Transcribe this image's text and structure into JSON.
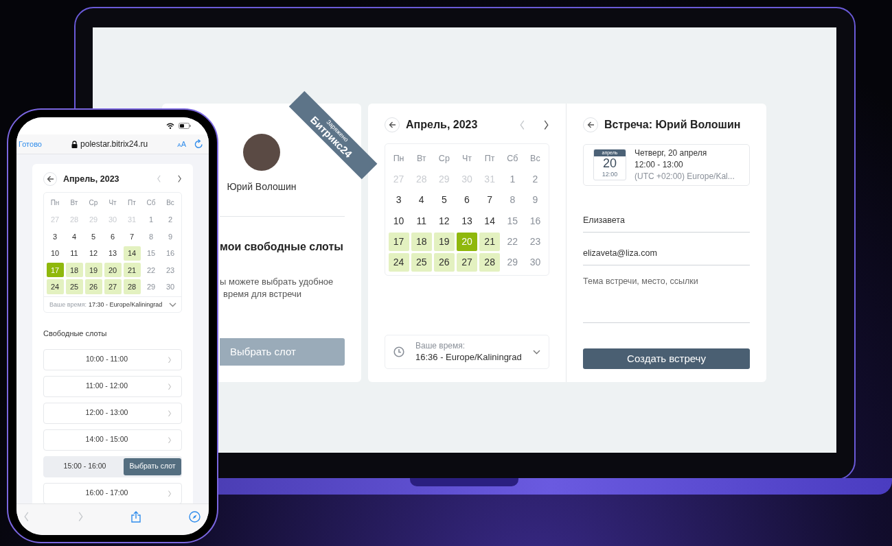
{
  "laptop": {
    "profile_card": {
      "ribbon": [
        "Заряжено",
        "Битрикс24"
      ],
      "name": "Юрий Волошин",
      "heading": "мои свободные слоты",
      "description": [
        "ы можете выбрать удобное",
        "время для встречи"
      ],
      "button": "Выбрать слот"
    },
    "calendar": {
      "title": "Апрель, 2023",
      "weekdays": [
        "Пн",
        "Вт",
        "Ср",
        "Чт",
        "Пт",
        "Сб",
        "Вс"
      ],
      "days": [
        {
          "label": "27",
          "kind": "outside",
          "available": false,
          "selected": false
        },
        {
          "label": "28",
          "kind": "outside",
          "available": false,
          "selected": false
        },
        {
          "label": "29",
          "kind": "outside",
          "available": false,
          "selected": false
        },
        {
          "label": "30",
          "kind": "outside",
          "available": false,
          "selected": false
        },
        {
          "label": "31",
          "kind": "outside",
          "available": false,
          "selected": false
        },
        {
          "label": "1",
          "kind": "weekend",
          "available": false,
          "selected": false
        },
        {
          "label": "2",
          "kind": "weekend",
          "available": false,
          "selected": false
        },
        {
          "label": "3",
          "kind": "workday",
          "available": false,
          "selected": false
        },
        {
          "label": "4",
          "kind": "workday",
          "available": false,
          "selected": false
        },
        {
          "label": "5",
          "kind": "workday",
          "available": false,
          "selected": false
        },
        {
          "label": "6",
          "kind": "workday",
          "available": false,
          "selected": false
        },
        {
          "label": "7",
          "kind": "workday",
          "available": false,
          "selected": false
        },
        {
          "label": "8",
          "kind": "weekend",
          "available": false,
          "selected": false
        },
        {
          "label": "9",
          "kind": "weekend",
          "available": false,
          "selected": false
        },
        {
          "label": "10",
          "kind": "workday",
          "available": false,
          "selected": false
        },
        {
          "label": "11",
          "kind": "workday",
          "available": false,
          "selected": false
        },
        {
          "label": "12",
          "kind": "workday",
          "available": false,
          "selected": false
        },
        {
          "label": "13",
          "kind": "workday",
          "available": false,
          "selected": false
        },
        {
          "label": "14",
          "kind": "workday",
          "available": false,
          "selected": false
        },
        {
          "label": "15",
          "kind": "weekend",
          "available": false,
          "selected": false
        },
        {
          "label": "16",
          "kind": "weekend",
          "available": false,
          "selected": false
        },
        {
          "label": "17",
          "kind": "workday",
          "available": true,
          "selected": false
        },
        {
          "label": "18",
          "kind": "workday",
          "available": true,
          "selected": false
        },
        {
          "label": "19",
          "kind": "workday",
          "available": true,
          "selected": false
        },
        {
          "label": "20",
          "kind": "workday",
          "available": true,
          "selected": true
        },
        {
          "label": "21",
          "kind": "workday",
          "available": true,
          "selected": false
        },
        {
          "label": "22",
          "kind": "weekend",
          "available": false,
          "selected": false
        },
        {
          "label": "23",
          "kind": "weekend",
          "available": false,
          "selected": false
        },
        {
          "label": "24",
          "kind": "workday",
          "available": true,
          "selected": false
        },
        {
          "label": "25",
          "kind": "workday",
          "available": true,
          "selected": false
        },
        {
          "label": "26",
          "kind": "workday",
          "available": true,
          "selected": false
        },
        {
          "label": "27",
          "kind": "workday",
          "available": true,
          "selected": false
        },
        {
          "label": "28",
          "kind": "workday",
          "available": true,
          "selected": false
        },
        {
          "label": "29",
          "kind": "weekend",
          "available": false,
          "selected": false
        },
        {
          "label": "30",
          "kind": "weekend",
          "available": false,
          "selected": false
        }
      ],
      "timezone": {
        "label": "Ваше время:",
        "value": "16:36 - Europe/Kaliningrad"
      }
    },
    "booking": {
      "title": "Встреча: Юрий Волошин",
      "date_badge": {
        "month": "апрель",
        "day": "20",
        "time": "12:00"
      },
      "details": [
        "Четверг, 20 апреля",
        "12:00 - 13:00",
        "(UTC +02:00) Europe/Kal..."
      ],
      "fields": [
        {
          "kind": "input",
          "value": "Елизавета"
        },
        {
          "kind": "input",
          "value": "elizaveta@liza.com"
        },
        {
          "kind": "textarea",
          "placeholder": "Тема встречи, место, ссылки"
        }
      ],
      "button": "Создать встречу"
    }
  },
  "phone": {
    "browser": {
      "done": "Готово",
      "url": "polestar.bitrix24.ru",
      "text_size": "AA"
    },
    "calendar": {
      "title": "Апрель, 2023",
      "weekdays": [
        "Пн",
        "Вт",
        "Ср",
        "Чт",
        "Пт",
        "Сб",
        "Вс"
      ],
      "days": [
        {
          "label": "27",
          "kind": "outside",
          "available": false,
          "selected": false
        },
        {
          "label": "28",
          "kind": "outside",
          "available": false,
          "selected": false
        },
        {
          "label": "29",
          "kind": "outside",
          "available": false,
          "selected": false
        },
        {
          "label": "30",
          "kind": "outside",
          "available": false,
          "selected": false
        },
        {
          "label": "31",
          "kind": "outside",
          "available": false,
          "selected": false
        },
        {
          "label": "1",
          "kind": "weekend",
          "available": false,
          "selected": false
        },
        {
          "label": "2",
          "kind": "weekend",
          "available": false,
          "selected": false
        },
        {
          "label": "3",
          "kind": "workday",
          "available": false,
          "selected": false
        },
        {
          "label": "4",
          "kind": "workday",
          "available": false,
          "selected": false
        },
        {
          "label": "5",
          "kind": "workday",
          "available": false,
          "selected": false
        },
        {
          "label": "6",
          "kind": "workday",
          "available": false,
          "selected": false
        },
        {
          "label": "7",
          "kind": "workday",
          "available": false,
          "selected": false
        },
        {
          "label": "8",
          "kind": "weekend",
          "available": false,
          "selected": false
        },
        {
          "label": "9",
          "kind": "weekend",
          "available": false,
          "selected": false
        },
        {
          "label": "10",
          "kind": "workday",
          "available": false,
          "selected": false
        },
        {
          "label": "11",
          "kind": "workday",
          "available": false,
          "selected": false
        },
        {
          "label": "12",
          "kind": "workday",
          "available": false,
          "selected": false
        },
        {
          "label": "13",
          "kind": "workday",
          "available": false,
          "selected": false
        },
        {
          "label": "14",
          "kind": "workday",
          "available": true,
          "selected": false
        },
        {
          "label": "15",
          "kind": "weekend",
          "available": false,
          "selected": false
        },
        {
          "label": "16",
          "kind": "weekend",
          "available": false,
          "selected": false
        },
        {
          "label": "17",
          "kind": "workday",
          "available": true,
          "selected": true
        },
        {
          "label": "18",
          "kind": "workday",
          "available": true,
          "selected": false
        },
        {
          "label": "19",
          "kind": "workday",
          "available": true,
          "selected": false
        },
        {
          "label": "20",
          "kind": "workday",
          "available": true,
          "selected": false
        },
        {
          "label": "21",
          "kind": "workday",
          "available": true,
          "selected": false
        },
        {
          "label": "22",
          "kind": "weekend",
          "available": false,
          "selected": false
        },
        {
          "label": "23",
          "kind": "weekend",
          "available": false,
          "selected": false
        },
        {
          "label": "24",
          "kind": "workday",
          "available": true,
          "selected": false
        },
        {
          "label": "25",
          "kind": "workday",
          "available": true,
          "selected": false
        },
        {
          "label": "26",
          "kind": "workday",
          "available": true,
          "selected": false
        },
        {
          "label": "27",
          "kind": "workday",
          "available": true,
          "selected": false
        },
        {
          "label": "28",
          "kind": "workday",
          "available": true,
          "selected": false
        },
        {
          "label": "29",
          "kind": "weekend",
          "available": false,
          "selected": false
        },
        {
          "label": "30",
          "kind": "weekend",
          "available": false,
          "selected": false
        }
      ],
      "timezone": {
        "label": "Ваше время:",
        "value": "17:30 - Europe/Kaliningrad"
      }
    },
    "slots_heading": "Свободные слоты",
    "select_button": "Выбрать слот",
    "slots": [
      {
        "label": "10:00 - 11:00",
        "selected": false
      },
      {
        "label": "11:00 - 12:00",
        "selected": false
      },
      {
        "label": "12:00 - 13:00",
        "selected": false
      },
      {
        "label": "14:00 - 15:00",
        "selected": false
      },
      {
        "label": "15:00 - 16:00",
        "selected": true
      },
      {
        "label": "16:00 - 17:00",
        "selected": false
      }
    ]
  }
}
